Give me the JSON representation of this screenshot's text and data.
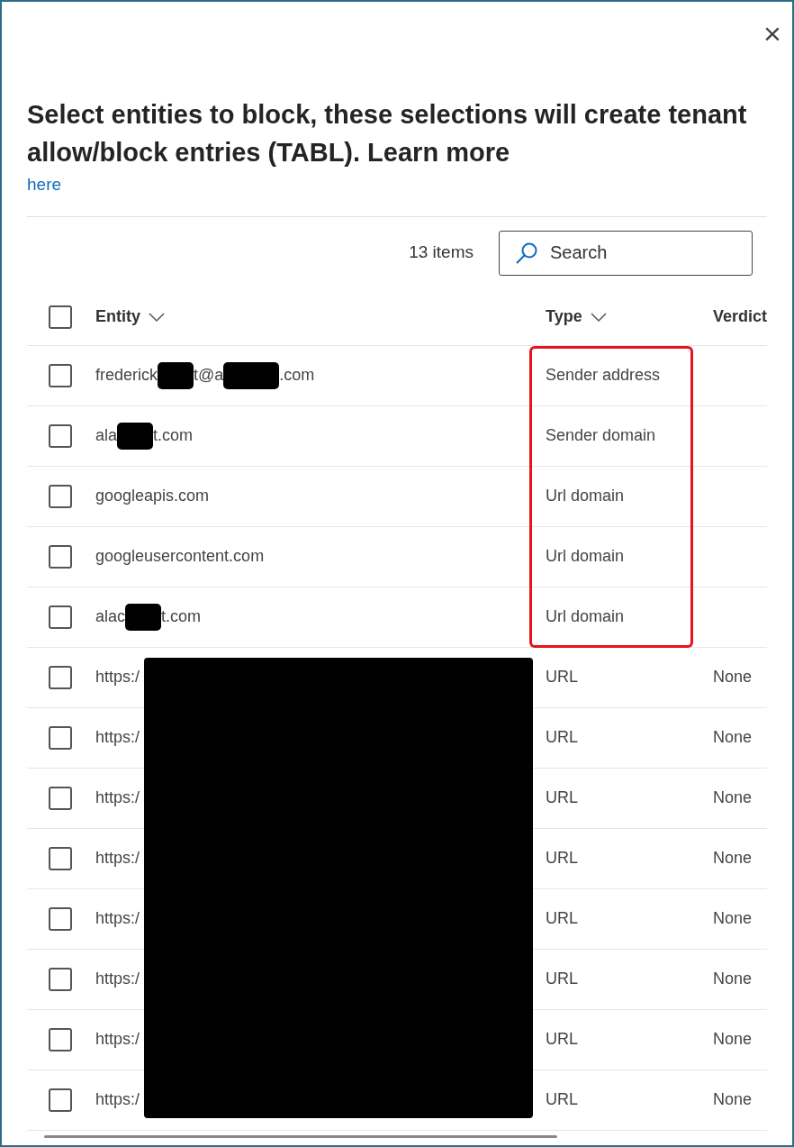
{
  "close_label": "×",
  "title": "Select entities to block, these selections will create tenant allow/block entries (TABL). Learn more",
  "link": "here",
  "item_count": "13 items",
  "search": {
    "placeholder": "Search"
  },
  "header_checkbox": {
    "checked": false
  },
  "columns": [
    {
      "label": "Entity",
      "sortable": true
    },
    {
      "label": "Type",
      "sortable": true
    },
    {
      "label": "Verdict",
      "sortable": false
    }
  ],
  "rows": [
    {
      "entity_parts": [
        "frederick",
        "t@a",
        ".com"
      ],
      "type": "Sender address",
      "checked": false,
      "highlighted": true,
      "redacted": false
    },
    {
      "entity_parts": [
        "ala",
        "t.com"
      ],
      "type": "Sender domain",
      "checked": false,
      "highlighted": true,
      "redacted": false
    },
    {
      "entity_parts": [
        "googleapis.com"
      ],
      "type": "Url domain",
      "checked": false,
      "highlighted": true,
      "redacted": false
    },
    {
      "entity_parts": [
        "googleusercontent.com"
      ],
      "type": "Url domain",
      "checked": false,
      "highlighted": true,
      "redacted": false
    },
    {
      "entity_parts": [
        "alac",
        "t.com"
      ],
      "type": "Url domain",
      "checked": false,
      "highlighted": true,
      "redacted": false
    },
    {
      "entity_parts": [
        "https:/"
      ],
      "type": "URL",
      "verdict": "None",
      "checked": false,
      "highlighted": false,
      "redacted": true
    },
    {
      "entity_parts": [
        "https:/"
      ],
      "type": "URL",
      "verdict": "None",
      "checked": false,
      "highlighted": false,
      "redacted": true
    },
    {
      "entity_parts": [
        "https:/"
      ],
      "type": "URL",
      "verdict": "None",
      "checked": false,
      "highlighted": false,
      "redacted": true
    },
    {
      "entity_parts": [
        "https:/"
      ],
      "type": "URL",
      "verdict": "None",
      "checked": false,
      "highlighted": false,
      "redacted": true
    },
    {
      "entity_parts": [
        "https:/"
      ],
      "type": "URL",
      "verdict": "None",
      "checked": false,
      "highlighted": false,
      "redacted": true
    },
    {
      "entity_parts": [
        "https:/"
      ],
      "type": "URL",
      "verdict": "None",
      "checked": false,
      "highlighted": false,
      "redacted": true
    },
    {
      "entity_parts": [
        "https:/"
      ],
      "type": "URL",
      "verdict": "None",
      "checked": false,
      "highlighted": false,
      "redacted": true
    },
    {
      "entity_parts": [
        "https:/"
      ],
      "type": "URL",
      "verdict": "None",
      "checked": false,
      "highlighted": false,
      "redacted": true
    }
  ]
}
